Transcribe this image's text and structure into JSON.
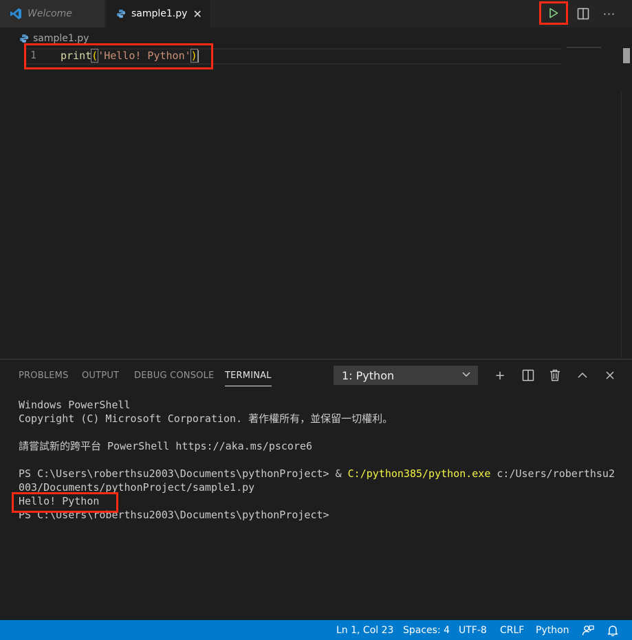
{
  "tabs": {
    "welcome": {
      "label": "Welcome",
      "icon": "vscode-icon"
    },
    "sample": {
      "label": "sample1.py",
      "icon": "python-icon",
      "close": "✕"
    }
  },
  "toolbar": {
    "run_icon": "▷",
    "split_icon": "split-editor-icon",
    "more_icon": "···"
  },
  "breadcrumb": {
    "file": "sample1.py"
  },
  "editor": {
    "line_number": "1",
    "code": {
      "fn": "print",
      "open": "(",
      "str": "'Hello! Python'",
      "close": ")"
    }
  },
  "panel": {
    "tabs": [
      "PROBLEMS",
      "OUTPUT",
      "DEBUG CONSOLE",
      "TERMINAL"
    ],
    "active_tab": "TERMINAL",
    "terminal_select": "1: Python",
    "buttons": {
      "add": "+",
      "split": "split-terminal-icon",
      "trash": "trash-icon",
      "maximize": "^",
      "close": "✕"
    }
  },
  "terminal": {
    "l1": "Windows PowerShell",
    "l2": "Copyright (C) Microsoft Corporation. 著作權所有，並保留一切權利。",
    "l3": "請嘗試新的跨平台 PowerShell https://aka.ms/pscore6",
    "l4_prompt": "PS C:\\Users\\roberthsu2003\\Documents\\pythonProject> & ",
    "l4_exe": "C:/python385/python.exe",
    "l4_rest": " c:/Users/roberthsu2",
    "l5": "003/Documents/pythonProject/sample1.py",
    "l6": "Hello! Python",
    "l7": "PS C:\\Users\\roberthsu2003\\Documents\\pythonProject>"
  },
  "statusbar": {
    "position": "Ln 1, Col 23",
    "spaces": "Spaces: 4",
    "encoding": "UTF-8",
    "eol": "CRLF",
    "language": "Python"
  },
  "colors": {
    "accent": "#007acc",
    "highlight": "#ff2a14"
  }
}
